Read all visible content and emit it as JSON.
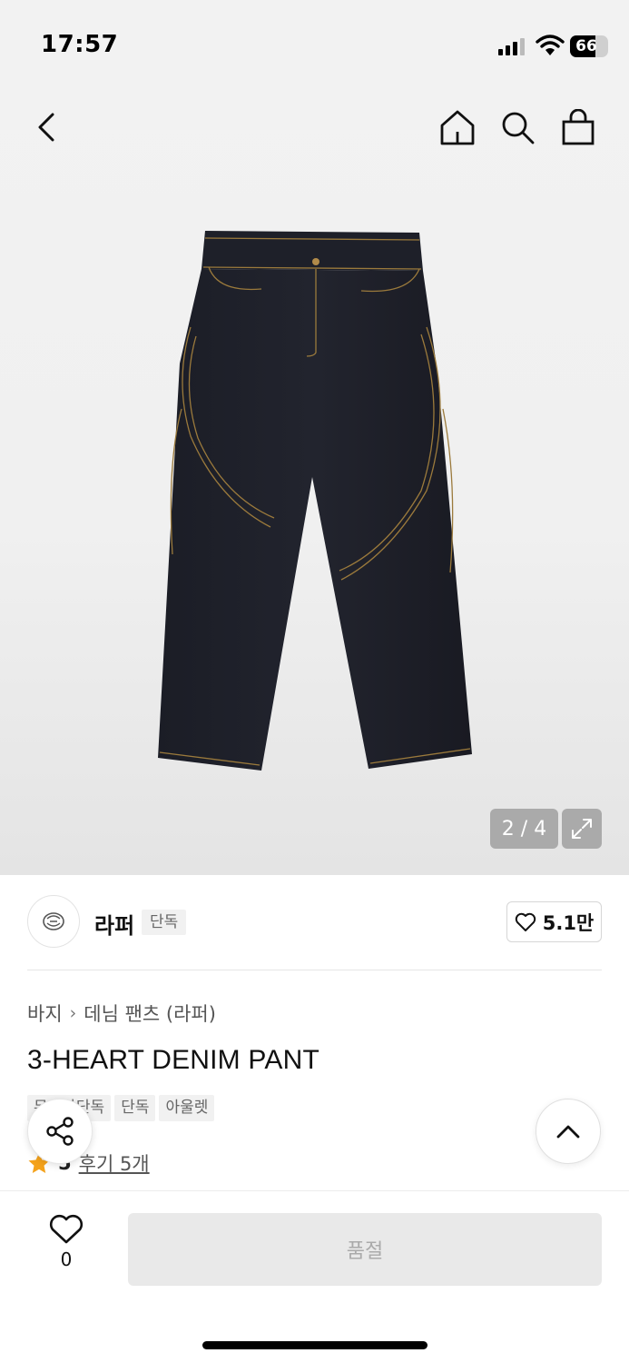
{
  "status_bar": {
    "time": "17:57",
    "battery": "66",
    "battery_level": 0.66
  },
  "gallery": {
    "counter": "2 / 4"
  },
  "brand": {
    "name": "라퍼",
    "badge": "단독",
    "likes": "5.1만"
  },
  "breadcrumb": {
    "category": "바지",
    "subcategory": "데님 팬츠 (라퍼)"
  },
  "product": {
    "title": "3-HEART DENIM PANT",
    "tags": [
      "무신사단독",
      "단독",
      "아울렛"
    ],
    "rating": "5",
    "reviews": "후기 5개"
  },
  "bottom_bar": {
    "wish_count": "0",
    "soldout_label": "품절"
  },
  "icons": [
    "back-arrow-icon",
    "home-icon",
    "search-icon",
    "shopping-bag-icon",
    "expand-icon",
    "brand-logo-icon",
    "heart-icon",
    "chevron-right-icon",
    "share-icon",
    "star-icon",
    "chevron-up-icon"
  ],
  "colors": {
    "accent_star": "#f4a21b",
    "soldout_bg": "#e9e9e9",
    "soldout_text": "#aaaaaa"
  }
}
